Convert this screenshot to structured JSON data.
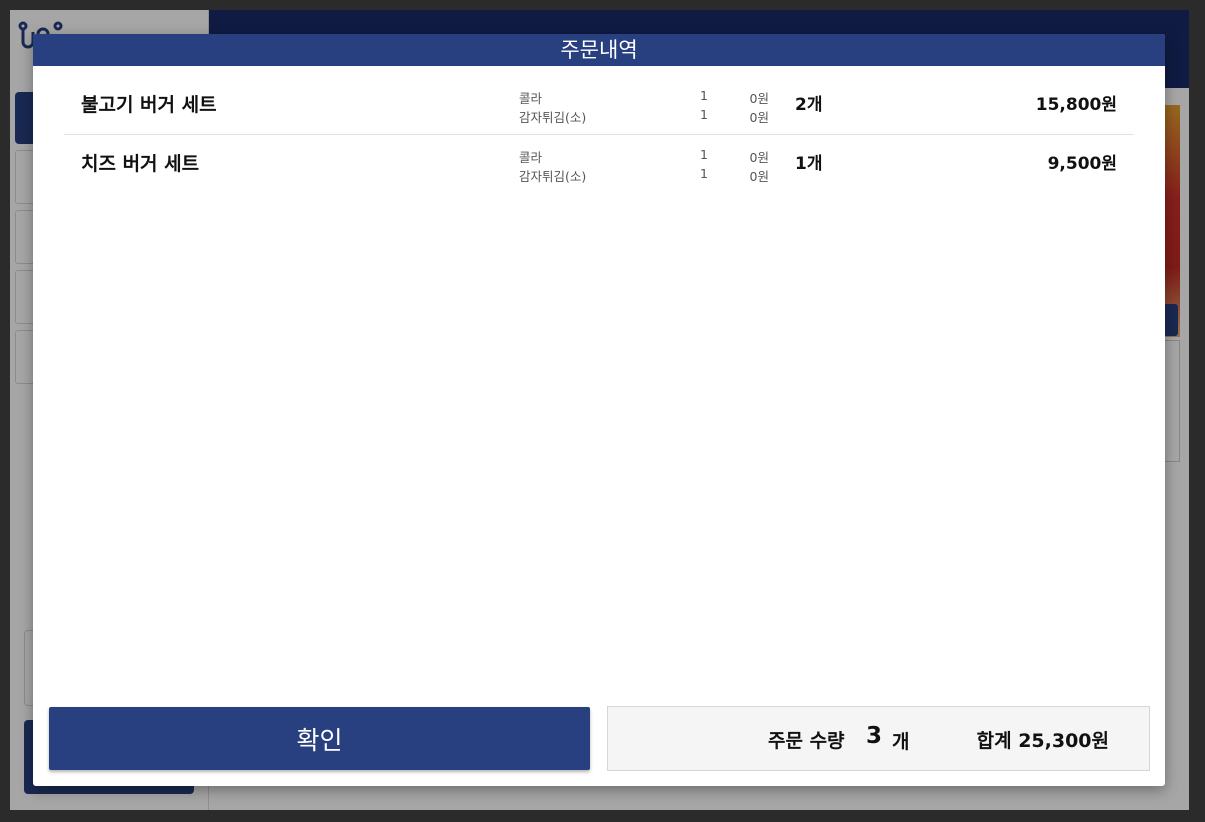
{
  "modal": {
    "title": "주문내역",
    "items": [
      {
        "name": "불고기 버거 세트",
        "options": [
          {
            "name": "콜라",
            "qty": "1",
            "price": "0원"
          },
          {
            "name": "감자튀김(소)",
            "qty": "1",
            "price": "0원"
          }
        ],
        "qty": "2개",
        "price": "15,800원"
      },
      {
        "name": "치즈 버거 세트",
        "options": [
          {
            "name": "콜라",
            "qty": "1",
            "price": "0원"
          },
          {
            "name": "감자튀김(소)",
            "qty": "1",
            "price": "0원"
          }
        ],
        "qty": "1개",
        "price": "9,500원"
      }
    ],
    "confirm_label": "확인",
    "summary": {
      "qty_label": "주문 수량",
      "qty_value": "3",
      "qty_unit": "개",
      "total": "합계 25,300원"
    }
  },
  "colors": {
    "primary": "#284080",
    "header_bar": "#1a2a68",
    "summary_bg": "#f5f5f5"
  }
}
